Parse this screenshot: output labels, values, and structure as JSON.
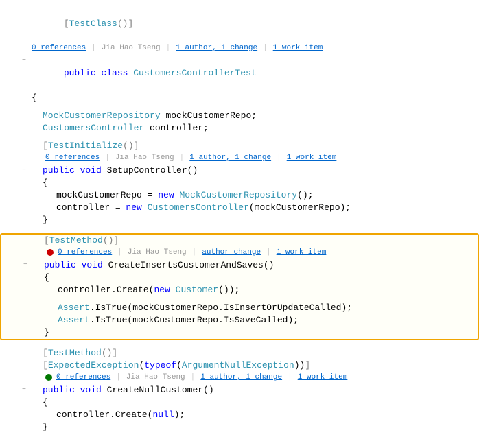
{
  "code": {
    "title": "CustomersControllerTest",
    "lines": []
  },
  "colors": {
    "keyword": "#0000ff",
    "type": "#2b91af",
    "string": "#a31515",
    "comment": "#008000",
    "orange_border": "#f0a500"
  },
  "labels": {
    "zero_references": "0 references",
    "author": "Jia Hao Tseng",
    "one_author": "1 author,",
    "one_change": "1 change",
    "one_work_item": "1 work item",
    "author_change": "author change"
  }
}
